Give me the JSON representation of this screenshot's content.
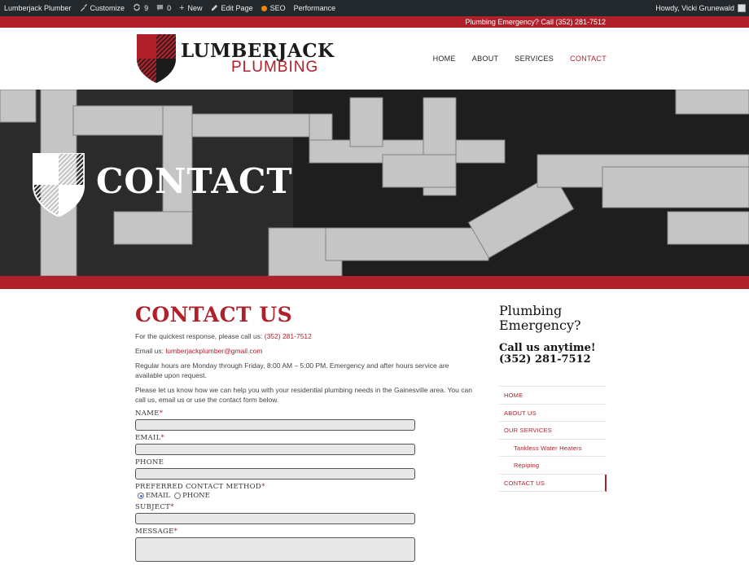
{
  "adminbar": {
    "site_name": "Lumberjack Plumber",
    "customize": "Customize",
    "updates_count": "9",
    "comments_count": "0",
    "new": "New",
    "edit_page": "Edit Page",
    "seo": "SEO",
    "performance": "Performance",
    "howdy": "Howdy, Vicki Grunewald"
  },
  "topbar": {
    "emergency": "Plumbing Emergency? Call (352) 281-7512"
  },
  "logo": {
    "line1": "LUMBERJACK",
    "line2": "PLUMBING"
  },
  "nav": {
    "items": [
      "HOME",
      "ABOUT",
      "SERVICES",
      "CONTACT"
    ],
    "active": "CONTACT"
  },
  "hero": {
    "title": "CONTACT"
  },
  "main": {
    "heading": "CONTACT US",
    "p1_prefix": "For the quickest response, please call us: ",
    "phone": "(352) 281-7512",
    "p2_prefix": "Email us: ",
    "email": "lumberjackplumber@gmail.com",
    "p3": "Regular hours are Monday through Friday, 8:00 AM – 5:00 PM. Emergency and after hours service are available upon request.",
    "p4": "Please let us know how we can help you with your residential plumbing needs in the Gainesville area. You can call us, email us or use the contact form below."
  },
  "form": {
    "name_label": "NAME",
    "email_label": "EMAIL",
    "phone_label": "PHONE",
    "method_label": "PREFERRED CONTACT METHOD",
    "method_options": [
      "EMAIL",
      "PHONE"
    ],
    "method_selected": "EMAIL",
    "subject_label": "SUBJECT",
    "message_label": "MESSAGE",
    "required_marker": "*"
  },
  "sidebar": {
    "title_line1": "Plumbing",
    "title_line2": "Emergency?",
    "call_line1": "Call us anytime!",
    "call_line2": "(352) 281-7512",
    "menu": [
      "HOME",
      "ABOUT US",
      "OUR SERVICES",
      "Tankless Water Heaters",
      "Repiping",
      "CONTACT US"
    ]
  },
  "colors": {
    "brand_red": "#b0202b",
    "admin_bar": "#23282d",
    "text_dark": "#1b1b1b"
  },
  "icons": [
    "wordpress-logo-icon",
    "brush-icon",
    "updates-icon",
    "comment-icon",
    "plus-icon",
    "pencil-icon",
    "seo-dot-icon",
    "shield-logo-icon"
  ]
}
